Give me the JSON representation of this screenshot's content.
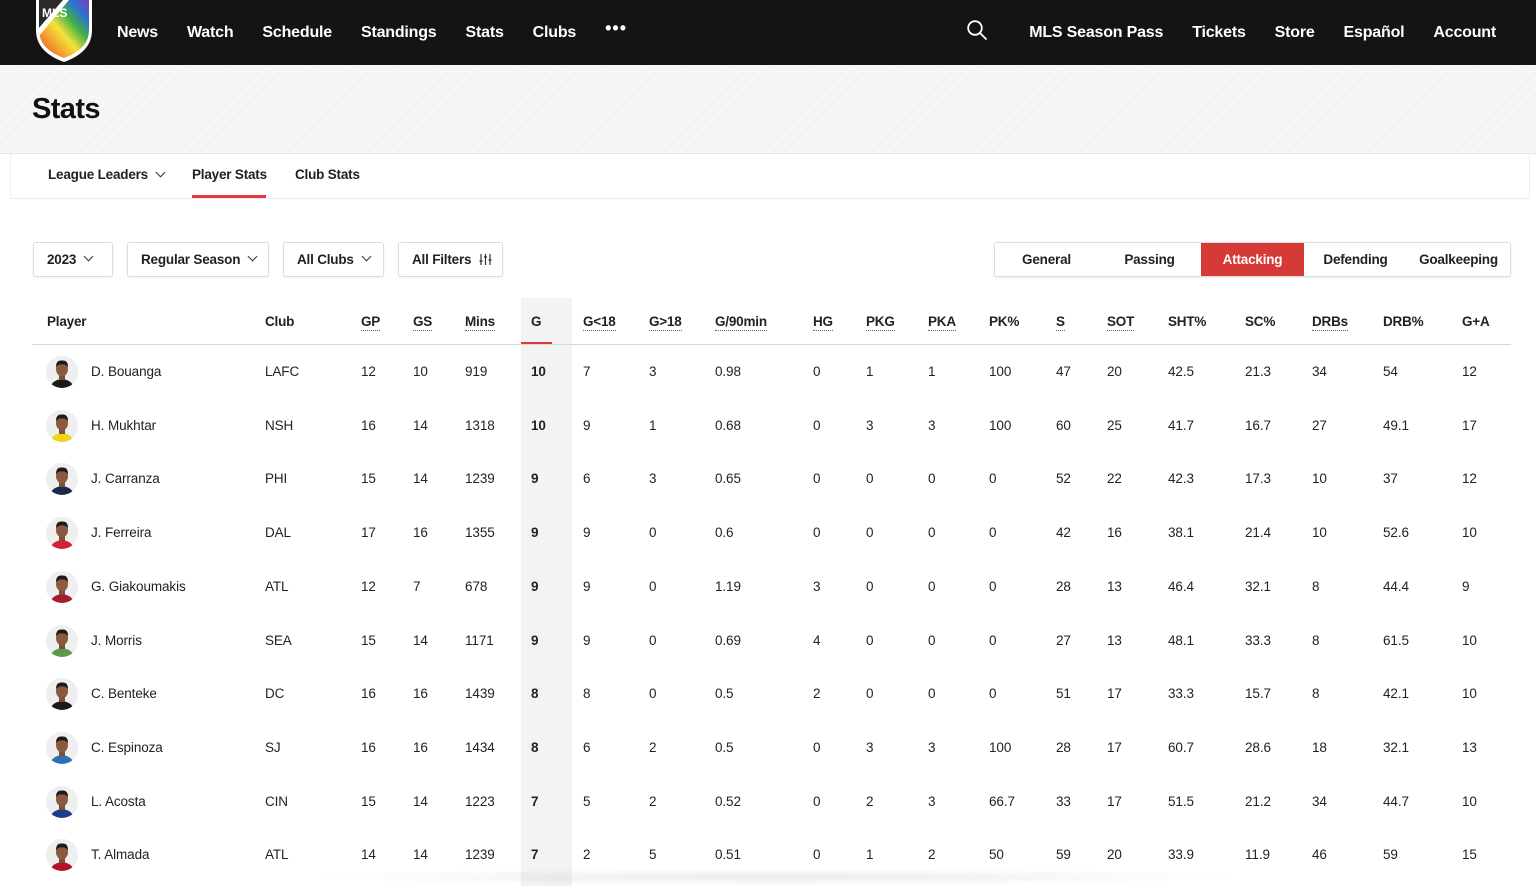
{
  "nav": {
    "left": [
      "News",
      "Watch",
      "Schedule",
      "Standings",
      "Stats",
      "Clubs"
    ],
    "more": "•••",
    "right": [
      "MLS Season Pass",
      "Tickets",
      "Store",
      "Español",
      "Account"
    ],
    "logo_text": "MLS"
  },
  "page_title": "Stats",
  "subtabs": {
    "league_leaders": "League Leaders",
    "player_stats": "Player Stats",
    "club_stats": "Club Stats",
    "active": "Player Stats"
  },
  "filters": {
    "season": "2023",
    "competition": "Regular Season",
    "clubs": "All Clubs",
    "all_filters": "All Filters"
  },
  "stat_categories": {
    "items": [
      "General",
      "Passing",
      "Attacking",
      "Defending",
      "Goalkeeping"
    ],
    "active": "Attacking"
  },
  "accent_color": "#d63a36",
  "table": {
    "headers": [
      "Player",
      "Club",
      "GP",
      "GS",
      "Mins",
      "G",
      "G<18",
      "G>18",
      "G/90min",
      "HG",
      "PKG",
      "PKA",
      "PK%",
      "S",
      "SOT",
      "SHT%",
      "SC%",
      "DRBs",
      "DRB%",
      "G+A"
    ],
    "sorted_column": "G",
    "rows": [
      [
        "D. Bouanga",
        "LAFC",
        "12",
        "10",
        "919",
        "10",
        "7",
        "3",
        "0.98",
        "0",
        "1",
        "1",
        "100",
        "47",
        "20",
        "42.5",
        "21.3",
        "34",
        "54",
        "12"
      ],
      [
        "H. Mukhtar",
        "NSH",
        "16",
        "14",
        "1318",
        "10",
        "9",
        "1",
        "0.68",
        "0",
        "3",
        "3",
        "100",
        "60",
        "25",
        "41.7",
        "16.7",
        "27",
        "49.1",
        "17"
      ],
      [
        "J. Carranza",
        "PHI",
        "15",
        "14",
        "1239",
        "9",
        "6",
        "3",
        "0.65",
        "0",
        "0",
        "0",
        "0",
        "52",
        "22",
        "42.3",
        "17.3",
        "10",
        "37",
        "12"
      ],
      [
        "J. Ferreira",
        "DAL",
        "17",
        "16",
        "1355",
        "9",
        "9",
        "0",
        "0.6",
        "0",
        "0",
        "0",
        "0",
        "42",
        "16",
        "38.1",
        "21.4",
        "10",
        "52.6",
        "10"
      ],
      [
        "G. Giakoumakis",
        "ATL",
        "12",
        "7",
        "678",
        "9",
        "9",
        "0",
        "1.19",
        "3",
        "0",
        "0",
        "0",
        "28",
        "13",
        "46.4",
        "32.1",
        "8",
        "44.4",
        "9"
      ],
      [
        "J. Morris",
        "SEA",
        "15",
        "14",
        "1171",
        "9",
        "9",
        "0",
        "0.69",
        "4",
        "0",
        "0",
        "0",
        "27",
        "13",
        "48.1",
        "33.3",
        "8",
        "61.5",
        "10"
      ],
      [
        "C. Benteke",
        "DC",
        "16",
        "16",
        "1439",
        "8",
        "8",
        "0",
        "0.5",
        "2",
        "0",
        "0",
        "0",
        "51",
        "17",
        "33.3",
        "15.7",
        "8",
        "42.1",
        "10"
      ],
      [
        "C. Espinoza",
        "SJ",
        "16",
        "16",
        "1434",
        "8",
        "6",
        "2",
        "0.5",
        "0",
        "3",
        "3",
        "100",
        "28",
        "17",
        "60.7",
        "28.6",
        "18",
        "32.1",
        "13"
      ],
      [
        "L. Acosta",
        "CIN",
        "15",
        "14",
        "1223",
        "7",
        "5",
        "2",
        "0.52",
        "0",
        "2",
        "3",
        "66.7",
        "33",
        "17",
        "51.5",
        "21.2",
        "34",
        "44.7",
        "10"
      ],
      [
        "T. Almada",
        "ATL",
        "14",
        "14",
        "1239",
        "7",
        "2",
        "5",
        "0.51",
        "0",
        "1",
        "2",
        "50",
        "59",
        "20",
        "33.9",
        "11.9",
        "46",
        "59",
        "15"
      ]
    ],
    "jersey_colors": [
      "#1a1a1a",
      "#f2d21b",
      "#1b2a4a",
      "#d0213a",
      "#a11d2b",
      "#5a9a4a",
      "#1a1a1a",
      "#2f6fb5",
      "#1d3c8a",
      "#b3102b"
    ]
  }
}
